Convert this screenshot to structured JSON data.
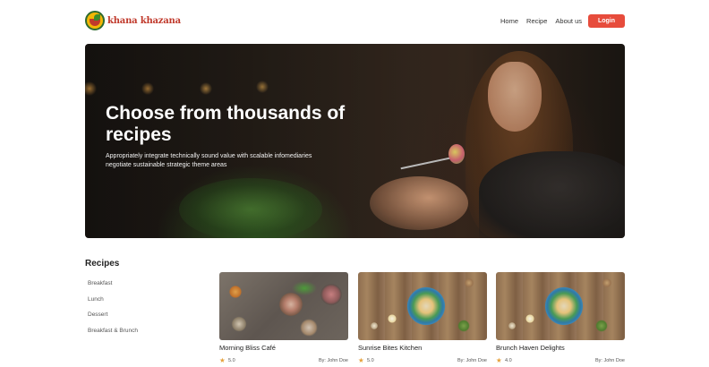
{
  "header": {
    "logo_text": "khana khazana",
    "nav": [
      "Home",
      "Recipe",
      "About us"
    ],
    "login_label": "Login"
  },
  "hero": {
    "title": "Choose from thousands of recipes",
    "subtitle": "Appropriately integrate technically sound value with scalable infomediaries negotiate sustainable strategic theme areas"
  },
  "sidebar": {
    "title": "Recipes",
    "items": [
      "Breakfast",
      "Lunch",
      "Dessert",
      "Breakfast & Brunch"
    ]
  },
  "cards": [
    {
      "name": "Morning Bliss Café",
      "rating": "5.0",
      "author": "By: John Doe",
      "image": "tapas-plates"
    },
    {
      "name": "Sunrise Bites Kitchen",
      "rating": "5.0",
      "author": "By: John Doe",
      "image": "salad-bowl"
    },
    {
      "name": "Brunch Haven Delights",
      "rating": "4.0",
      "author": "By: John Doe",
      "image": "salad-bowl"
    }
  ],
  "colors": {
    "accent": "#e74c3c",
    "star": "#e6a23c",
    "logo": "#c0392b"
  },
  "icons": {
    "logo": "khana-khazana-logo-icon",
    "rating": "star-icon"
  }
}
